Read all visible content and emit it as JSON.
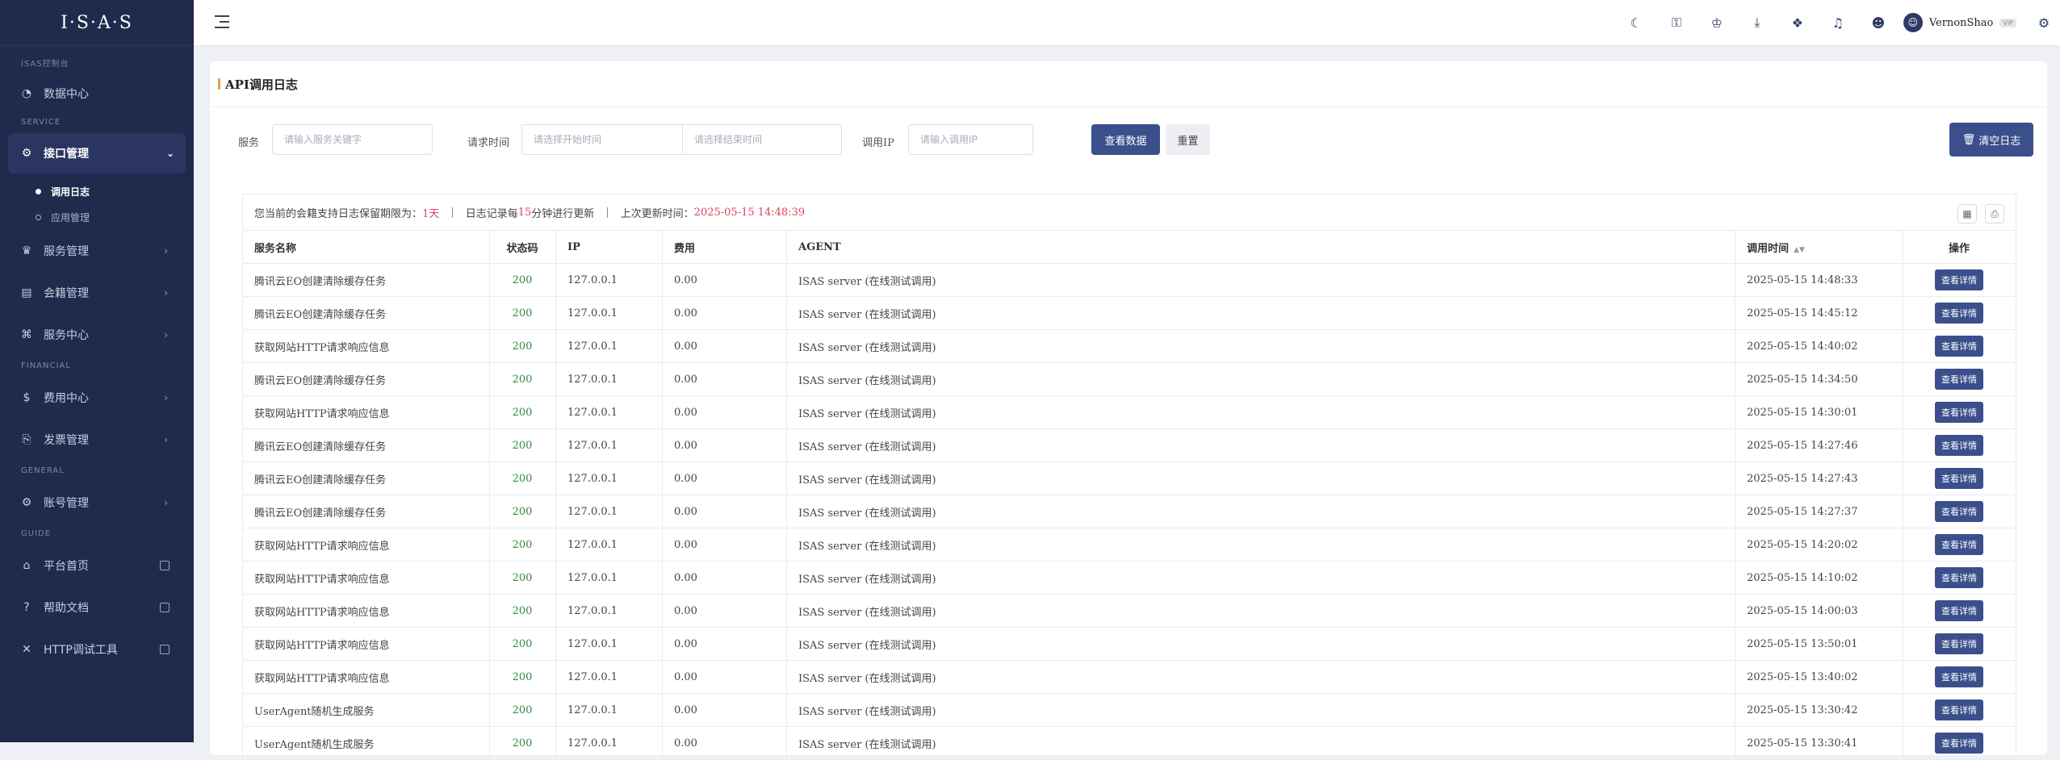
{
  "app": {
    "logo": "I·S·A·S"
  },
  "sidebar": {
    "sections": [
      {
        "title": "ISAS控制台",
        "items": [
          {
            "label": "数据中心",
            "icon": "dashboard-icon"
          }
        ]
      },
      {
        "title": "SERVICE",
        "items": [
          {
            "label": "接口管理",
            "icon": "api-icon",
            "active": true,
            "children": [
              {
                "label": "调用日志",
                "active": true
              },
              {
                "label": "应用管理"
              }
            ]
          },
          {
            "label": "服务管理",
            "icon": "service-icon"
          },
          {
            "label": "会籍管理",
            "icon": "membership-icon"
          },
          {
            "label": "服务中心",
            "icon": "command-icon"
          }
        ]
      },
      {
        "title": "FINANCIAL",
        "items": [
          {
            "label": "费用中心",
            "icon": "fee-icon"
          },
          {
            "label": "发票管理",
            "icon": "invoice-icon"
          }
        ]
      },
      {
        "title": "GENERAL",
        "items": [
          {
            "label": "账号管理",
            "icon": "settings-icon"
          }
        ]
      },
      {
        "title": "GUIDE",
        "items": [
          {
            "label": "平台首页",
            "icon": "home-icon"
          },
          {
            "label": "帮助文档",
            "icon": "help-icon"
          },
          {
            "label": "HTTP调试工具",
            "icon": "tools-icon"
          }
        ]
      }
    ]
  },
  "topbar": {
    "icons": [
      "moon-icon",
      "key-icon",
      "crown-icon",
      "download-icon",
      "apps-icon",
      "bell-icon",
      "user-icon"
    ],
    "user": {
      "name": "VernonShao",
      "badge": "VIP"
    }
  },
  "page": {
    "title": "API调用日志",
    "filters": {
      "service_label": "服务",
      "service_placeholder": "请输入服务关键字",
      "time_label": "请求时间",
      "start_placeholder": "请选择开始时间",
      "end_placeholder": "请选择结束时间",
      "ip_label": "调用IP",
      "ip_placeholder": "请输入调用IP",
      "query_button": "查看数据",
      "reset_button": "重置",
      "clear_button": "清空日志"
    },
    "info": {
      "retention_prefix": "您当前的会籍支持日志保留期限为：",
      "retention_value": "1天",
      "update_prefix": "日志记录每",
      "update_value": "15",
      "update_suffix": "分钟进行更新",
      "last_prefix": "上次更新时间：",
      "last_value": "2025-05-15 14:48:39"
    },
    "table": {
      "headers": [
        "服务名称",
        "状态码",
        "IP",
        "费用",
        "AGENT",
        "调用时间",
        "操作"
      ],
      "action_label": "查看详情",
      "rows": [
        [
          "腾讯云EO创建清除缓存任务",
          "200",
          "127.0.0.1",
          "0.00",
          "ISAS server (在线测试调用)",
          "2025-05-15 14:48:33"
        ],
        [
          "腾讯云EO创建清除缓存任务",
          "200",
          "127.0.0.1",
          "0.00",
          "ISAS server (在线测试调用)",
          "2025-05-15 14:45:12"
        ],
        [
          "获取网站HTTP请求响应信息",
          "200",
          "127.0.0.1",
          "0.00",
          "ISAS server (在线测试调用)",
          "2025-05-15 14:40:02"
        ],
        [
          "腾讯云EO创建清除缓存任务",
          "200",
          "127.0.0.1",
          "0.00",
          "ISAS server (在线测试调用)",
          "2025-05-15 14:34:50"
        ],
        [
          "获取网站HTTP请求响应信息",
          "200",
          "127.0.0.1",
          "0.00",
          "ISAS server (在线测试调用)",
          "2025-05-15 14:30:01"
        ],
        [
          "腾讯云EO创建清除缓存任务",
          "200",
          "127.0.0.1",
          "0.00",
          "ISAS server (在线测试调用)",
          "2025-05-15 14:27:46"
        ],
        [
          "腾讯云EO创建清除缓存任务",
          "200",
          "127.0.0.1",
          "0.00",
          "ISAS server (在线测试调用)",
          "2025-05-15 14:27:43"
        ],
        [
          "腾讯云EO创建清除缓存任务",
          "200",
          "127.0.0.1",
          "0.00",
          "ISAS server (在线测试调用)",
          "2025-05-15 14:27:37"
        ],
        [
          "获取网站HTTP请求响应信息",
          "200",
          "127.0.0.1",
          "0.00",
          "ISAS server (在线测试调用)",
          "2025-05-15 14:20:02"
        ],
        [
          "获取网站HTTP请求响应信息",
          "200",
          "127.0.0.1",
          "0.00",
          "ISAS server (在线测试调用)",
          "2025-05-15 14:10:02"
        ],
        [
          "获取网站HTTP请求响应信息",
          "200",
          "127.0.0.1",
          "0.00",
          "ISAS server (在线测试调用)",
          "2025-05-15 14:00:03"
        ],
        [
          "获取网站HTTP请求响应信息",
          "200",
          "127.0.0.1",
          "0.00",
          "ISAS server (在线测试调用)",
          "2025-05-15 13:50:01"
        ],
        [
          "获取网站HTTP请求响应信息",
          "200",
          "127.0.0.1",
          "0.00",
          "ISAS server (在线测试调用)",
          "2025-05-15 13:40:02"
        ],
        [
          "UserAgent随机生成服务",
          "200",
          "127.0.0.1",
          "0.00",
          "ISAS server (在线测试调用)",
          "2025-05-15 13:30:42"
        ],
        [
          "UserAgent随机生成服务",
          "200",
          "127.0.0.1",
          "0.00",
          "ISAS server (在线测试调用)",
          "2025-05-15 13:30:41"
        ]
      ]
    }
  }
}
